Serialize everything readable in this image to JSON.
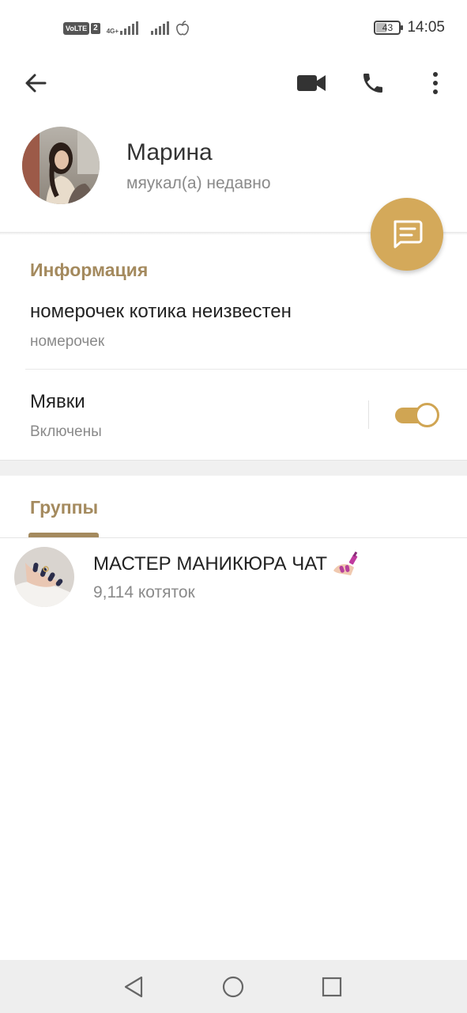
{
  "status_bar": {
    "volte": "VoLTE",
    "sim": "2",
    "network": "4G+",
    "battery": "43",
    "battery_level": 0.43,
    "time": "14:05"
  },
  "toolbar": {
    "back_icon": "arrow-left-icon",
    "video_icon": "video-camera-icon",
    "call_icon": "phone-icon",
    "menu_icon": "more-vertical-icon"
  },
  "profile": {
    "name": "Марина",
    "status": "мяукал(а) недавно",
    "avatar": "profile-photo",
    "fab_icon": "message-icon",
    "accent": "#d4a95a"
  },
  "info": {
    "title": "Информация",
    "phone_value": "номерочек котика неизвестен",
    "phone_label": "номерочек",
    "notifications_title": "Мявки",
    "notifications_value": "Включены",
    "notifications_enabled": true
  },
  "groups": {
    "tab_label": "Группы",
    "items": [
      {
        "name": "МАСТЕР МАНИКЮРА ЧАТ",
        "emoji_icon": "nail-polish-icon",
        "members": "9,114 котяток"
      }
    ]
  },
  "nav": {
    "back": "triangle-back-icon",
    "home": "circle-home-icon",
    "recents": "square-recents-icon"
  }
}
